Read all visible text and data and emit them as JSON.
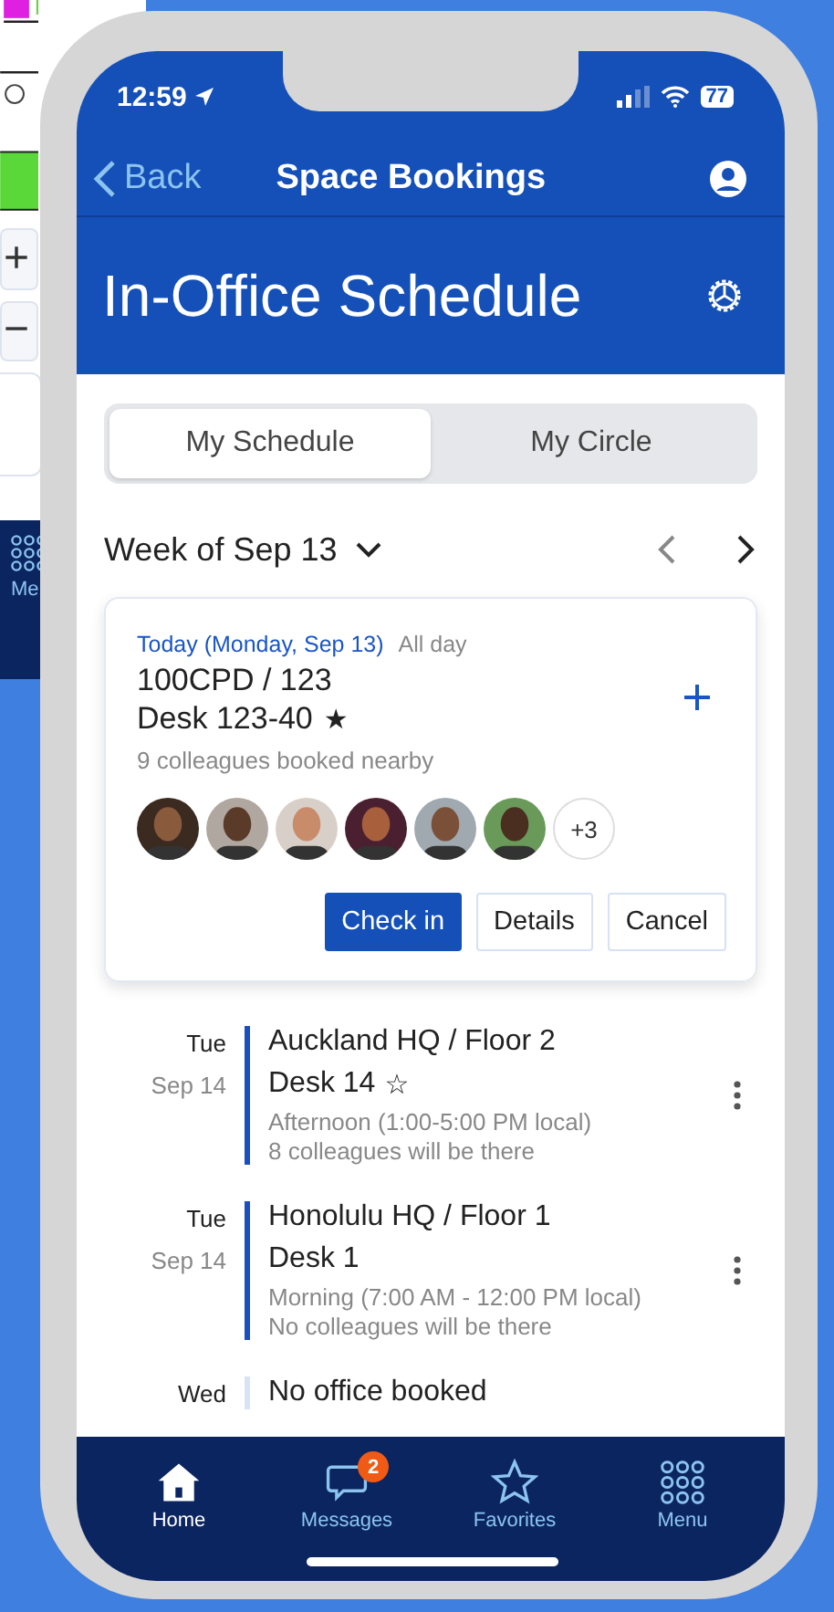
{
  "background_window": {
    "zoom_in": "+",
    "zoom_out": "−",
    "menu_label": "Me"
  },
  "status_bar": {
    "time": "12:59",
    "battery": "77"
  },
  "nav": {
    "back": "Back",
    "title": "Space Bookings"
  },
  "header": {
    "title": "In-Office Schedule"
  },
  "segments": [
    {
      "label": "My Schedule",
      "selected": true
    },
    {
      "label": "My Circle",
      "selected": false
    }
  ],
  "week": {
    "label": "Week of Sep 13"
  },
  "today": {
    "date": "Today (Monday, Sep 13)",
    "duration": "All day",
    "location": "100CPD / 123",
    "desk": "Desk 123-40",
    "star": "★",
    "nearby": "9 colleagues booked nearby",
    "more": "+3",
    "actions": [
      {
        "label": "Check in",
        "kind": "primary"
      },
      {
        "label": "Details",
        "kind": "outline"
      },
      {
        "label": "Cancel",
        "kind": "outline"
      }
    ]
  },
  "bookings": [
    {
      "kind": "booked",
      "day": "Tue",
      "date": "Sep 14",
      "location": "Auckland HQ / Floor 2",
      "desk": "Desk 14",
      "star": "☆",
      "time": "Afternoon (1:00-5:00 PM local)",
      "colleagues": "8 colleagues will be there"
    },
    {
      "kind": "booked",
      "day": "Tue",
      "date": "Sep 14",
      "location": "Honolulu HQ / Floor 1",
      "desk": "Desk 1",
      "time": "Morning (7:00 AM - 12:00 PM local)",
      "colleagues": "No colleagues will be there"
    },
    {
      "kind": "empty",
      "day": "Wed",
      "location": "No office booked"
    }
  ],
  "tab_bar": [
    {
      "label": "Home",
      "kind": "home",
      "selected": true
    },
    {
      "label": "Messages",
      "kind": "messages",
      "selected": false,
      "badge": "2"
    },
    {
      "label": "Favorites",
      "kind": "favorites",
      "selected": false
    },
    {
      "label": "Menu",
      "kind": "menu",
      "selected": false
    }
  ]
}
